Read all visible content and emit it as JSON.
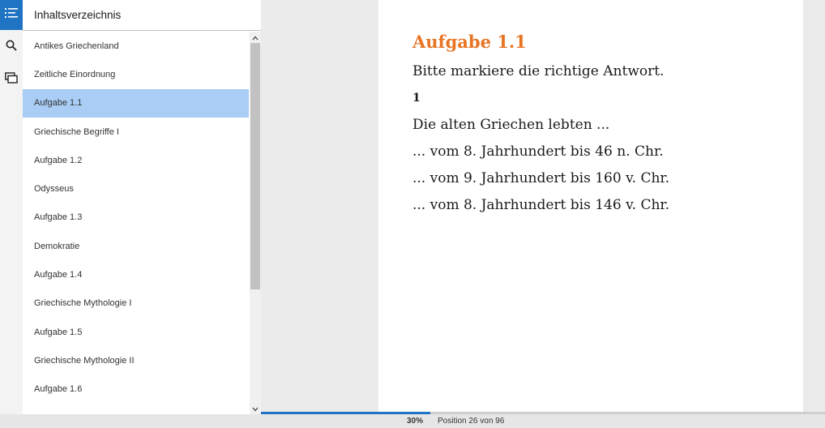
{
  "toc": {
    "title": "Inhaltsverzeichnis",
    "items": [
      {
        "label": "Antikes Griechenland"
      },
      {
        "label": "Zeitliche Einordnung"
      },
      {
        "label": "Aufgabe 1.1",
        "selected": true
      },
      {
        "label": "Griechische Begriffe I"
      },
      {
        "label": "Aufgabe 1.2"
      },
      {
        "label": "Odysseus"
      },
      {
        "label": "Aufgabe 1.3"
      },
      {
        "label": "Demokratie"
      },
      {
        "label": "Aufgabe 1.4"
      },
      {
        "label": "Griechische Mythologie I"
      },
      {
        "label": "Aufgabe 1.5"
      },
      {
        "label": "Griechische Mythologie II"
      },
      {
        "label": "Aufgabe 1.6"
      }
    ]
  },
  "rail": {
    "icons": [
      "toc-icon",
      "search-icon",
      "pages-icon"
    ]
  },
  "page": {
    "title": "Aufgabe 1.1",
    "instruction": "Bitte markiere die richtige Antwort.",
    "question_number": "1",
    "question": "Die alten Griechen lebten ...",
    "options": [
      "... vom 8. Jahrhundert bis 46 n. Chr.",
      "... vom 9. Jahrhundert bis 160 v. Chr.",
      "... vom 8. Jahrhundert bis 146 v. Chr."
    ]
  },
  "status": {
    "percent_label": "30%",
    "progress": 0.3,
    "position_label": "Position 26 von 96"
  },
  "colors": {
    "accent": "#1f74c4",
    "title": "#e87424",
    "selected": "#a9cdf5"
  }
}
